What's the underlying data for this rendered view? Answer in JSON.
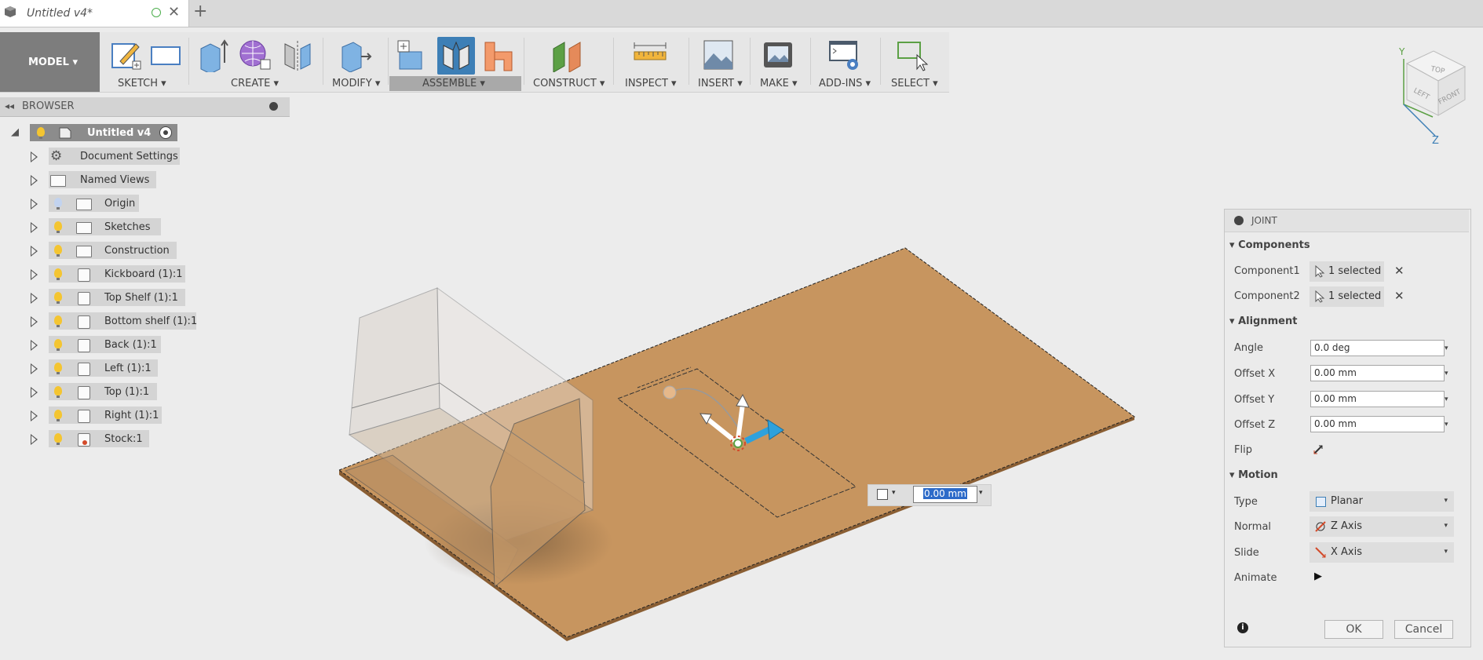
{
  "tab": {
    "title": "Untitled v4*"
  },
  "toolbar": {
    "mode": "MODEL",
    "groups": [
      "SKETCH",
      "CREATE",
      "MODIFY",
      "ASSEMBLE",
      "CONSTRUCT",
      "INSPECT",
      "INSERT",
      "MAKE",
      "ADD-INS",
      "SELECT"
    ]
  },
  "browser": {
    "title": "BROWSER",
    "root": "Untitled v4",
    "items": [
      {
        "label": "Document Settings",
        "icon": "gear-icon"
      },
      {
        "label": "Named Views",
        "icon": "folder-icon"
      },
      {
        "label": "Origin",
        "icon": "folder-icon"
      },
      {
        "label": "Sketches",
        "icon": "folder-icon"
      },
      {
        "label": "Construction",
        "icon": "folder-icon"
      },
      {
        "label": "Kickboard (1):1",
        "icon": "component-icon"
      },
      {
        "label": "Top Shelf (1):1",
        "icon": "component-icon"
      },
      {
        "label": "Bottom shelf (1):1",
        "icon": "component-icon"
      },
      {
        "label": "Back (1):1",
        "icon": "component-icon"
      },
      {
        "label": "Left (1):1",
        "icon": "component-icon"
      },
      {
        "label": "Top (1):1",
        "icon": "component-icon"
      },
      {
        "label": "Right (1):1",
        "icon": "component-icon"
      },
      {
        "label": "Stock:1",
        "icon": "component-icon"
      }
    ]
  },
  "viewcube": {
    "top": "TOP",
    "left": "LEFT",
    "front": "FRONT",
    "axis_y": "Y",
    "axis_z": "Z"
  },
  "viewport": {
    "offset_value": "0.00 mm"
  },
  "joint": {
    "title": "JOINT",
    "components": {
      "heading": "Components",
      "c1_label": "Component1",
      "c1_value": "1 selected",
      "c2_label": "Component2",
      "c2_value": "1 selected"
    },
    "alignment": {
      "heading": "Alignment",
      "angle_label": "Angle",
      "angle": "0.0 deg",
      "ox_label": "Offset X",
      "ox": "0.00 mm",
      "oy_label": "Offset Y",
      "oy": "0.00 mm",
      "oz_label": "Offset Z",
      "oz": "0.00 mm",
      "flip_label": "Flip"
    },
    "motion": {
      "heading": "Motion",
      "type_label": "Type",
      "type": "Planar",
      "normal_label": "Normal",
      "normal": "Z Axis",
      "slide_label": "Slide",
      "slide": "X Axis",
      "animate_label": "Animate"
    },
    "ok": "OK",
    "cancel": "Cancel"
  },
  "colors": {
    "accent": "#3d7fb6",
    "wood": "#c7955f",
    "ground": "#ececec"
  }
}
